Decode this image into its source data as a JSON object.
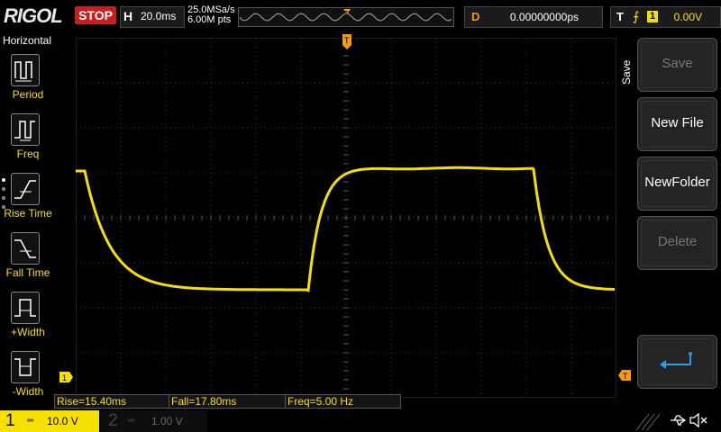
{
  "brand": "RIGOL",
  "run_state": "STOP",
  "horizontal": {
    "key": "H",
    "timebase": "20.0ms"
  },
  "acquisition": {
    "sample_rate": "25.0MSa/s",
    "memory_depth": "6.00M pts"
  },
  "delay": {
    "key": "D",
    "value": "0.00000000ps"
  },
  "trigger": {
    "key": "T",
    "source": "1",
    "level": "0.00V"
  },
  "markers": {
    "trigger_pos": "T",
    "ch1_ground": "1"
  },
  "left_menu": {
    "title": "Horizontal",
    "items": [
      {
        "label": "Period",
        "icon": "period-icon"
      },
      {
        "label": "Freq",
        "icon": "frequency-icon"
      },
      {
        "label": "Rise Time",
        "icon": "rise-time-icon"
      },
      {
        "label": "Fall Time",
        "icon": "fall-time-icon"
      },
      {
        "label": "+Width",
        "icon": "positive-width-icon"
      },
      {
        "label": "-Width",
        "icon": "negative-width-icon"
      }
    ]
  },
  "right_menu": {
    "title": "Save",
    "buttons": [
      {
        "label": "Save",
        "enabled": false
      },
      {
        "label": "New File",
        "enabled": true
      },
      {
        "label": "NewFolder",
        "enabled": true
      },
      {
        "label": "Delete",
        "enabled": false
      }
    ],
    "return_icon": "return-arrow-icon"
  },
  "measurements": {
    "rise": "Rise=15.40ms",
    "fall": "Fall=17.80ms",
    "freq": "Freq=5.00 Hz"
  },
  "channels": [
    {
      "number": "1",
      "scale": "10.0 V",
      "active": true
    },
    {
      "number": "2",
      "scale": "1.00 V",
      "active": false
    }
  ],
  "status_icons": [
    "usb-icon",
    "speaker-muted-icon"
  ],
  "colors": {
    "ch1": "#f5e000",
    "trigger": "#f39c12",
    "stop": "#c81e1e",
    "grid": "#3a3a3a"
  }
}
